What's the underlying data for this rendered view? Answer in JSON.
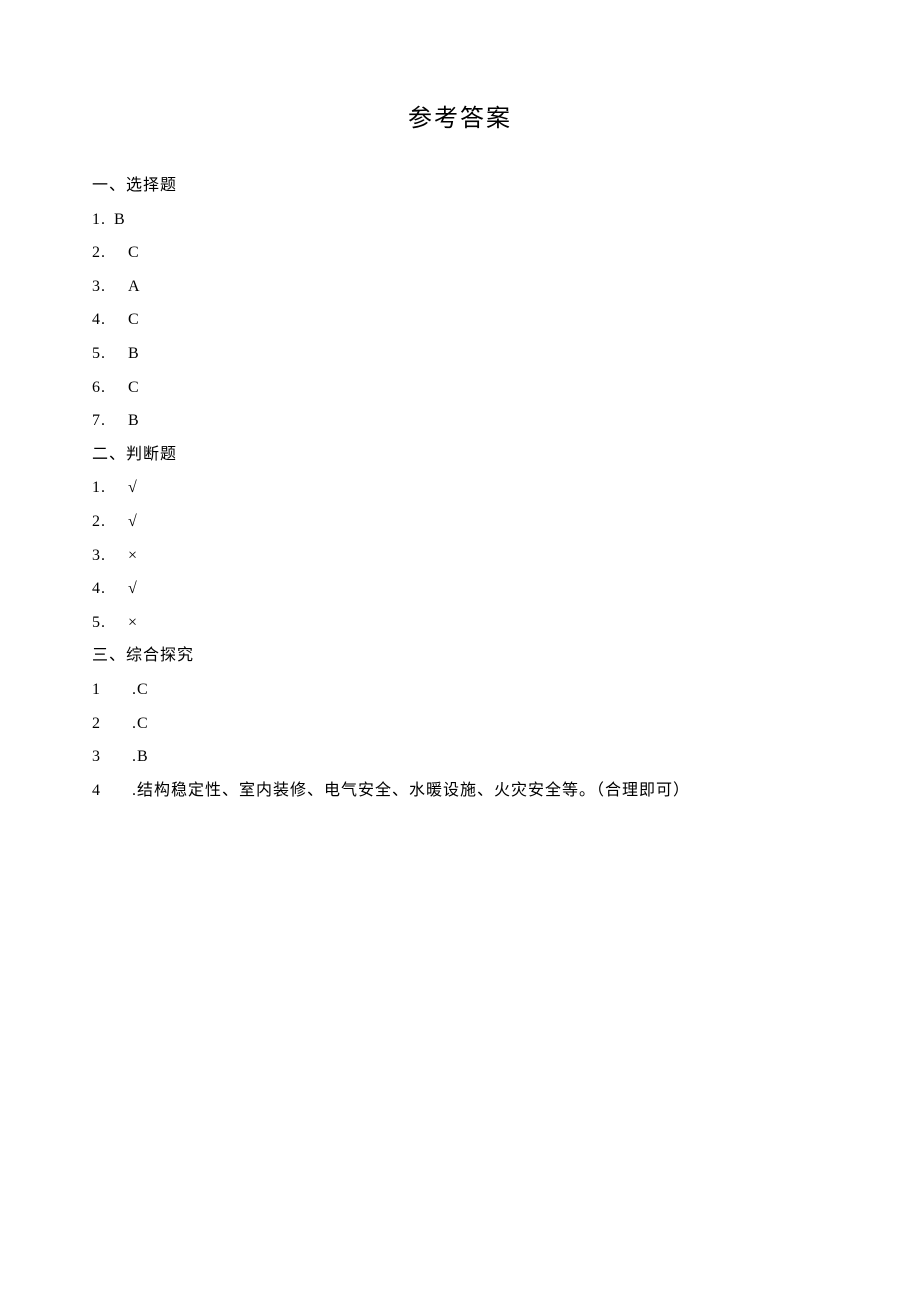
{
  "title": "参考答案",
  "sections": [
    {
      "header": "一、选择题",
      "items": [
        {
          "num": "1.",
          "sep": "tight",
          "ans": "B"
        },
        {
          "num": "2.",
          "sep": "dot",
          "ans": "C"
        },
        {
          "num": "3.",
          "sep": "dot",
          "ans": "A"
        },
        {
          "num": "4.",
          "sep": "dot",
          "ans": "C"
        },
        {
          "num": "5.",
          "sep": "dot",
          "ans": "B"
        },
        {
          "num": "6.",
          "sep": "dot",
          "ans": "C"
        },
        {
          "num": "7.",
          "sep": "dot",
          "ans": "B"
        }
      ]
    },
    {
      "header": "二、判断题",
      "items": [
        {
          "num": "1.",
          "sep": "dot",
          "ans": "√"
        },
        {
          "num": "2.",
          "sep": "dot",
          "ans": "√"
        },
        {
          "num": "3.",
          "sep": "dot",
          "ans": "×"
        },
        {
          "num": "4.",
          "sep": "dot",
          "ans": "√"
        },
        {
          "num": "5.",
          "sep": "dot",
          "ans": "×"
        }
      ]
    },
    {
      "header": "三、综合探究",
      "items": [
        {
          "num": "1",
          "sep": "wide",
          "ans": ".C"
        },
        {
          "num": "2",
          "sep": "wide",
          "ans": ".C"
        },
        {
          "num": "3",
          "sep": "wide",
          "ans": ".B"
        },
        {
          "num": "4",
          "sep": "wide",
          "ans": ".结构稳定性、室内装修、电气安全、水暖设施、火灾安全等。（合理即可）"
        }
      ]
    }
  ]
}
